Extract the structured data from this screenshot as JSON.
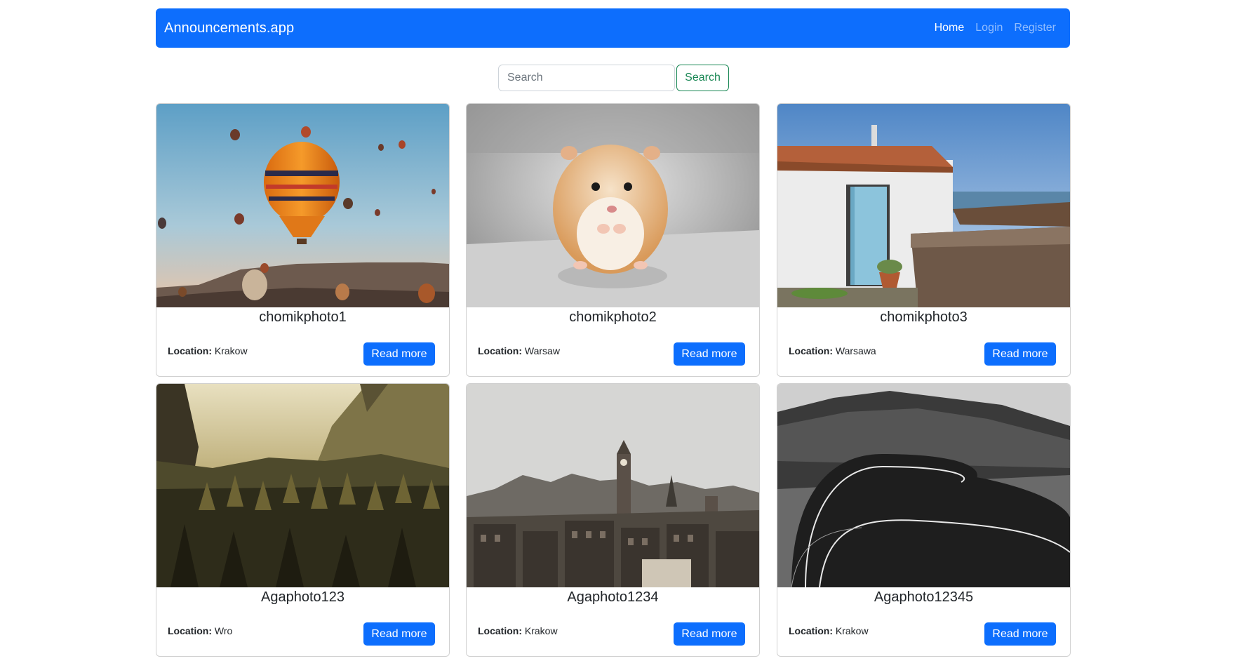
{
  "navbar": {
    "brand": "Announcements.app",
    "links": [
      "Home",
      "Login",
      "Register"
    ],
    "accent": "#0d6efd"
  },
  "search": {
    "placeholder": "Search",
    "value": "",
    "button_label": "Search",
    "button_color": "#198754"
  },
  "cards": [
    {
      "title": "chomikphoto1",
      "location_label": "Location:",
      "location": "Krakow",
      "button_label": "Read more",
      "image": "hot-air-balloons"
    },
    {
      "title": "chomikphoto2",
      "location_label": "Location:",
      "location": "Warsaw",
      "button_label": "Read more",
      "image": "hamster"
    },
    {
      "title": "chomikphoto3",
      "location_label": "Location:",
      "location": "Warsawa",
      "button_label": "Read more",
      "image": "white-cottage-by-sea"
    },
    {
      "title": "Agaphoto123",
      "location_label": "Location:",
      "location": "Wro",
      "button_label": "Read more",
      "image": "misty-forest-valley"
    },
    {
      "title": "Agaphoto1234",
      "location_label": "Location:",
      "location": "Krakow",
      "button_label": "Read more",
      "image": "city-skyline-clock-tower"
    },
    {
      "title": "Agaphoto12345",
      "location_label": "Location:",
      "location": "Krakow",
      "button_label": "Read more",
      "image": "winding-mountain-road"
    }
  ]
}
